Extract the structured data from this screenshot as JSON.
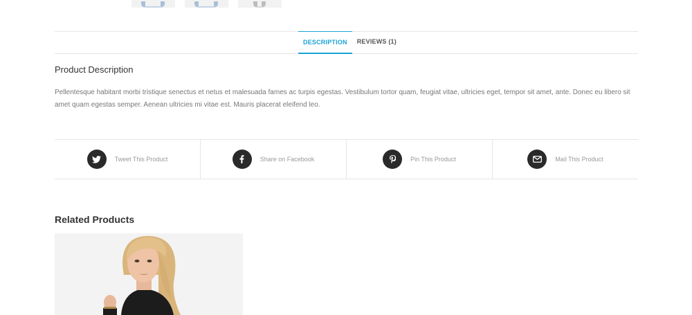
{
  "tabs": [
    {
      "label": "DESCRIPTION",
      "active": true
    },
    {
      "label": "REVIEWS (1)",
      "active": false
    }
  ],
  "description": {
    "title": "Product Description",
    "text": "Pellentesque habitant morbi tristique senectus et netus et malesuada fames ac turpis egestas. Vestibulum tortor quam, feugiat vitae, ultricies eget, tempor sit amet, ante. Donec eu libero sit amet quam egestas semper. Aenean ultricies mi vitae est. Mauris placerat eleifend leo."
  },
  "share": [
    {
      "label": "Tweet This Product",
      "icon": "twitter-icon"
    },
    {
      "label": "Share on Facebook",
      "icon": "facebook-icon"
    },
    {
      "label": "Pin This Product",
      "icon": "pinterest-icon"
    },
    {
      "label": "Mail This Product",
      "icon": "mail-icon"
    }
  ],
  "related": {
    "title": "Related Products"
  },
  "colors": {
    "accent": "#1aa3d6",
    "icon_bg": "#2a2a2a"
  }
}
